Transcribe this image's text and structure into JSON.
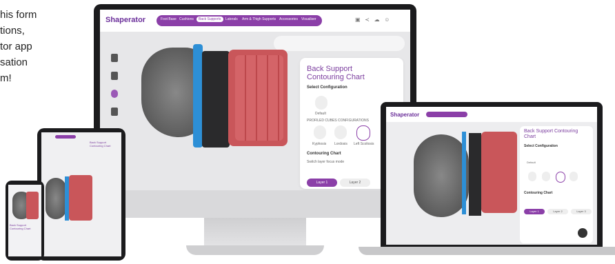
{
  "caption": {
    "lines": [
      "his form",
      "tions,",
      "tor app",
      "sation",
      "m!"
    ]
  },
  "app": {
    "logo": "Shaperator",
    "nav": [
      "Foot Base",
      "Cushions",
      "Back Supports",
      "Laterals",
      "Arm & Thigh Supports",
      "Accessories",
      "Visualiser"
    ],
    "nav_active_index": 2,
    "topbar_icons": [
      "save-icon",
      "share-icon",
      "cart-icon",
      "user-icon"
    ],
    "panel": {
      "title": "Back Support Contouring Chart",
      "select_config": "Select Configuration",
      "default_label": "Default",
      "profiled_label": "PROFILED CUBES CONFIGURATIONS",
      "options": [
        "Kyphosis",
        "Lordosis",
        "Left Scoliosis"
      ],
      "contouring_chart": "Contouring Chart",
      "switch_text": "Switch layer focus mode",
      "layers": [
        "Layer 1",
        "Layer 2"
      ]
    }
  },
  "laptop": {
    "logo": "Shaperator",
    "panel_title": "Back Support Contouring Chart",
    "select_config": "Select Configuration",
    "default_label": "Default",
    "options": [
      "Kyphosis",
      "Lordosis",
      "Left Scoliosis",
      "Right Scoliosis"
    ],
    "contouring_chart": "Contouring Chart",
    "layers": [
      "Layer 1",
      "Layer 2",
      "Layer 3"
    ]
  },
  "tablet": {
    "title": "Back Support Contouring Chart"
  },
  "phone": {
    "title": "Back Support Contouring Chart"
  },
  "colors": {
    "accent": "#8b3fa8",
    "blue": "#2d8fd6",
    "red": "#c9565a"
  }
}
